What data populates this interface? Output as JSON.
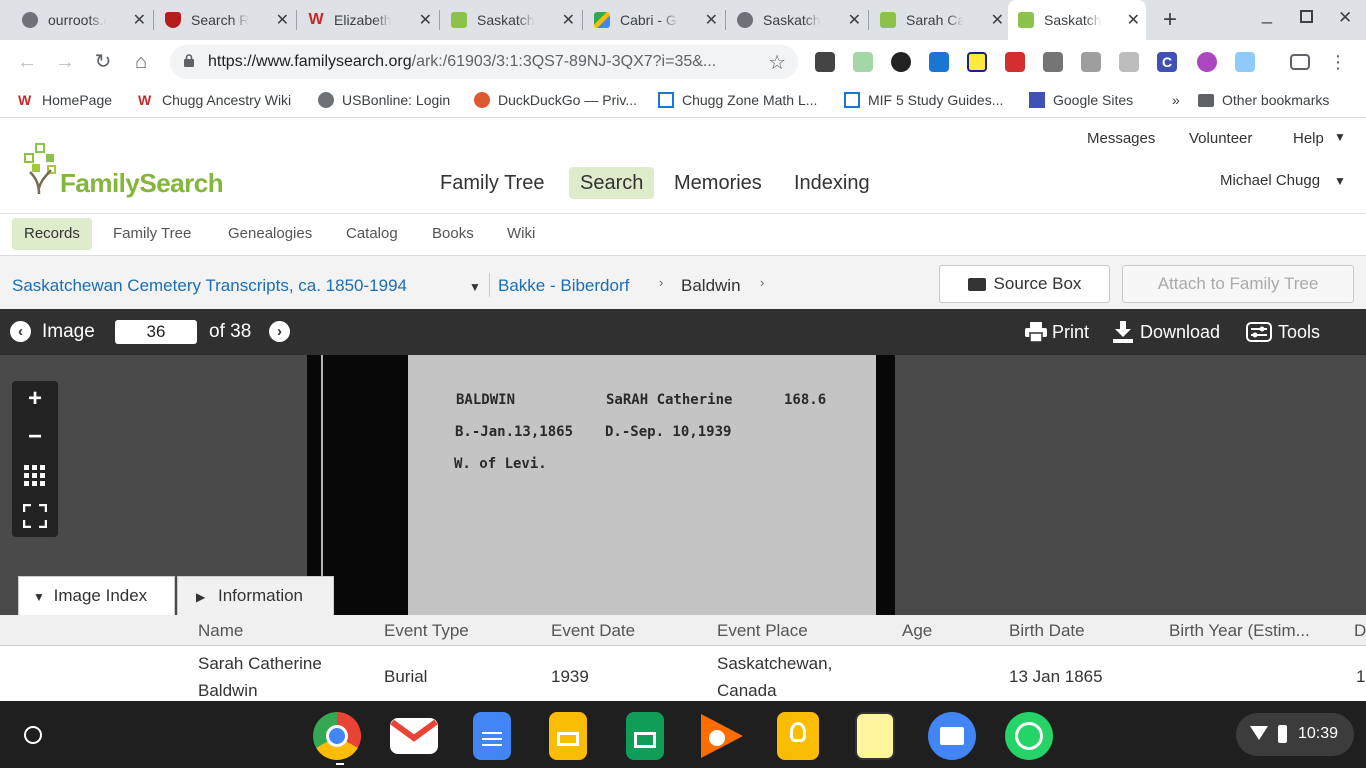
{
  "browser": {
    "tabs": [
      {
        "label": "ourroots.ca",
        "icon": "globe-icon",
        "color": "#5f6368"
      },
      {
        "label": "Search Results",
        "icon": "crest-icon",
        "color": "#b71c1c"
      },
      {
        "label": "Elizabeth",
        "icon": "w-logo-icon",
        "color": "#c62828"
      },
      {
        "label": "Saskatchewan",
        "icon": "familysearch-tree-icon",
        "color": "#8bc34a"
      },
      {
        "label": "Cabri - Google Maps",
        "icon": "maps-icon",
        "color": "#34a853"
      },
      {
        "label": "Saskatchewan",
        "icon": "globe-icon",
        "color": "#5f6368"
      },
      {
        "label": "Sarah Catherine",
        "icon": "familysearch-tree-icon",
        "color": "#8bc34a"
      },
      {
        "label": "Saskatchewan",
        "icon": "familysearch-tree-icon",
        "color": "#8bc34a"
      }
    ],
    "url_host": "https://www.familysearch.org",
    "url_path": "/ark:/61903/3:1:3QS7-89NJ-3QX7?i=35&...",
    "bookmarks": [
      {
        "label": "HomePage",
        "icon": "w-logo-icon"
      },
      {
        "label": "Chugg Ancestry Wiki",
        "icon": "w-logo-icon"
      },
      {
        "label": "USBonline: Login",
        "icon": "globe-icon"
      },
      {
        "label": "DuckDuckGo — Priv...",
        "icon": "duckduckgo-icon"
      },
      {
        "label": "Chugg Zone Math L...",
        "icon": "page-icon"
      },
      {
        "label": "MIF 5 Study Guides...",
        "icon": "page-icon"
      },
      {
        "label": "Google Sites",
        "icon": "sites-icon"
      },
      {
        "label": "»",
        "icon": "chevron-right-icon"
      },
      {
        "label": "Other bookmarks",
        "icon": "folder-icon"
      }
    ]
  },
  "site": {
    "logo_text": "FamilySearch",
    "top_links": [
      "Messages",
      "Volunteer",
      "Help"
    ],
    "main_nav": [
      "Family Tree",
      "Search",
      "Memories",
      "Indexing"
    ],
    "active_main": "Search",
    "user_name": "Michael Chugg",
    "sub_nav": [
      "Records",
      "Family Tree",
      "Genealogies",
      "Catalog",
      "Books",
      "Wiki"
    ],
    "active_sub": "Records"
  },
  "breadcrumb": {
    "collection": "Saskatchewan Cemetery Transcripts, ca. 1850-1994",
    "range": "Bakke - Biberdorf",
    "current": "Baldwin",
    "source_box": "Source Box",
    "attach": "Attach to Family Tree"
  },
  "image_bar": {
    "label": "Image",
    "page": "36",
    "of_text": "of 38",
    "print": "Print",
    "download": "Download",
    "tools": "Tools"
  },
  "record_card": {
    "surname": "BALDWIN",
    "given": "SaRAH Catherine",
    "number": "168.6",
    "birth": "B.-Jan.13,1865",
    "death": "D.-Sep. 10,1939",
    "relation": "W. of Levi."
  },
  "panel_tabs": [
    "Image Index",
    "Information"
  ],
  "index_table": {
    "headers": [
      "Name",
      "Event Type",
      "Event Date",
      "Event Place",
      "Age",
      "Birth Date",
      "Birth Year (Estim...",
      "D"
    ],
    "rows": [
      {
        "name_line1": "Sarah Catherine",
        "name_line2": "Baldwin",
        "event_type": "Burial",
        "event_date": "1939",
        "place_line1": "Saskatchewan,",
        "place_line2": "Canada",
        "age": "",
        "birth_date": "13 Jan 1865",
        "birth_year": "",
        "extra": "1"
      }
    ]
  },
  "shelf": {
    "apps": [
      "chrome-icon",
      "gmail-icon",
      "docs-icon",
      "slides-icon",
      "sheets-icon",
      "play-music-icon",
      "keep-icon",
      "notes-icon",
      "files-icon",
      "whatsapp-icon"
    ],
    "time": "10:39"
  }
}
